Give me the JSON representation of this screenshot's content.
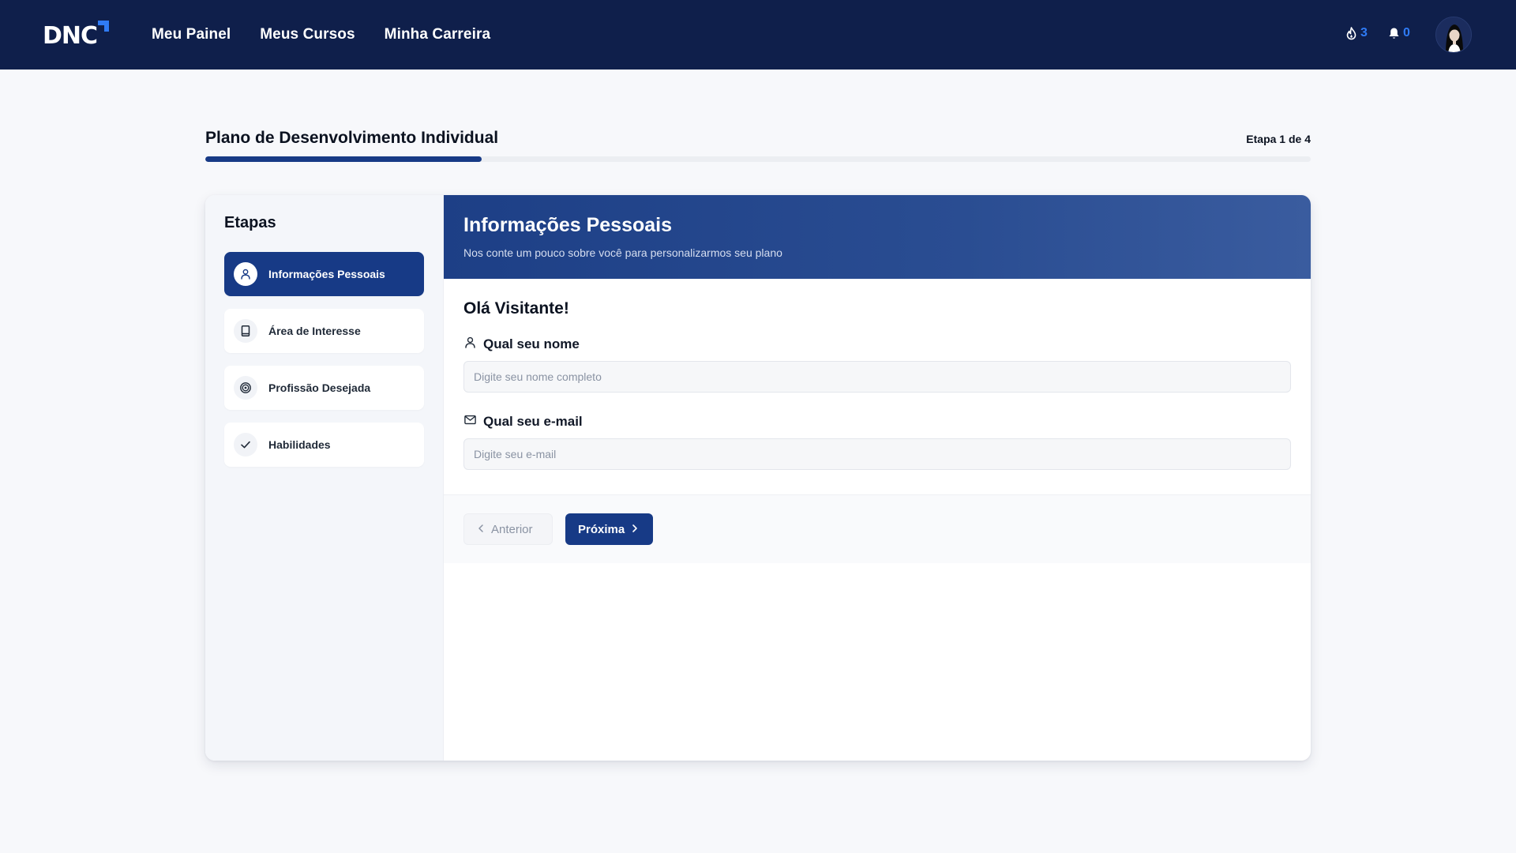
{
  "brand": {
    "logo_text": "DNC",
    "accent": "#2f7bf5",
    "navy": "#0f1f4b",
    "primary": "#173a86"
  },
  "nav": {
    "items": [
      {
        "label": "Meu Painel"
      },
      {
        "label": "Meus Cursos"
      },
      {
        "label": "Minha Carreira"
      }
    ]
  },
  "header_counters": {
    "streak": {
      "icon": "fire-icon",
      "value": "3"
    },
    "notifications": {
      "icon": "bell-icon",
      "value": "0"
    }
  },
  "plan": {
    "title": "Plano de Desenvolvimento Individual",
    "step_label": "Etapa 1 de 4",
    "progress": 0.25
  },
  "sidebar": {
    "title": "Etapas",
    "items": [
      {
        "label": "Informações Pessoais",
        "icon": "user-icon",
        "active": true
      },
      {
        "label": "Área de Interesse",
        "icon": "book-icon",
        "active": false
      },
      {
        "label": "Profissão Desejada",
        "icon": "target-icon",
        "active": false
      },
      {
        "label": "Habilidades",
        "icon": "check-icon",
        "active": false
      }
    ]
  },
  "section": {
    "title": "Informações Pessoais",
    "subtitle": "Nos conte um pouco sobre você para personalizarmos seu plano"
  },
  "form": {
    "greeting": "Olá Visitante!",
    "name": {
      "label": "Qual seu nome",
      "placeholder": "Digite seu nome completo",
      "value": ""
    },
    "email": {
      "label": "Qual seu e-mail",
      "placeholder": "Digite seu e-mail",
      "value": ""
    }
  },
  "actions": {
    "prev_label": "Anterior",
    "next_label": "Próxima"
  }
}
